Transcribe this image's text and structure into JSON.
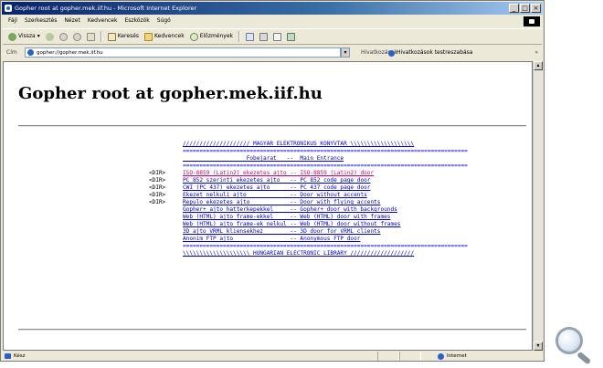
{
  "window": {
    "title": "Gopher root at gopher.mek.iif.hu - Microsoft Internet Explorer"
  },
  "menubar": {
    "items": [
      "Fájl",
      "Szerkesztés",
      "Nézet",
      "Kedvencek",
      "Eszközök",
      "Súgó"
    ]
  },
  "toolbar": {
    "back": "Vissza",
    "search": "Keresés",
    "favorites": "Kedvencek",
    "history": "Előzmények"
  },
  "addressbar": {
    "label": "Cím",
    "url": "gopher://gopher.mek.iif.hu",
    "links_label": "Hivatkozások",
    "links_item": "Hivatkozások testreszabása"
  },
  "page": {
    "title": "Gopher root at gopher.mek.iif.hu",
    "dir_tag": "<DIR>",
    "header_lines": [
      "//////////////////// MAGYAR ELEKTRONIKUS KONYVTAR \\\\\\\\\\\\\\\\\\\\\\\\\\\\\\\\\\\\\\",
      "=====================================================================================",
      "                   Fobejarat   --  Main Entrance",
      "====================================================================================="
    ],
    "entries": [
      {
        "dir": true,
        "text": "ISO-8859 (Latin2) ekezetes ajto -- ISO-8859 (Latin2) door",
        "visited": true
      },
      {
        "dir": true,
        "text": "PC 852 szerinti ekezetes ajto   -- PC 852 code page door",
        "visited": false
      },
      {
        "dir": true,
        "text": "CWI (PC 437) ekezetes ajto      -- PC 437 code page door",
        "visited": false
      },
      {
        "dir": true,
        "text": "Ekezet nelkuli ajto             -- Door without accents",
        "visited": false
      },
      {
        "dir": true,
        "text": "Repulo ekezetes ajto            -- Door with flying accents",
        "visited": false
      },
      {
        "dir": false,
        "text": "Gopher+ ajto hatterkepekkel     -- Gopher+ door with backgrounds",
        "visited": false
      },
      {
        "dir": false,
        "text": "Web (HTML) ajto frame-ekkel     -- Web (HTML) door with frames",
        "visited": false
      },
      {
        "dir": false,
        "text": "Web (HTML) ajto frame-ek nelkul -- Web (HTML) door without frames",
        "visited": false
      },
      {
        "dir": false,
        "text": "3D ajto VRML kliensekhez        -- 3D door for VRML clients",
        "visited": false
      },
      {
        "dir": false,
        "text": "Anonim FTP ajto                 -- Anonymous FTP door",
        "visited": false
      }
    ],
    "footer_lines": [
      "=====================================================================================",
      "\\\\\\\\\\\\\\\\\\\\\\\\\\\\\\\\\\\\\\\\ HUNGARIAN ELECTRONIC LIBRARY ///////////////////"
    ]
  },
  "statusbar": {
    "text": "Kész",
    "zone": "Internet"
  },
  "icons": {
    "magnifier": "magnifier-icon"
  }
}
